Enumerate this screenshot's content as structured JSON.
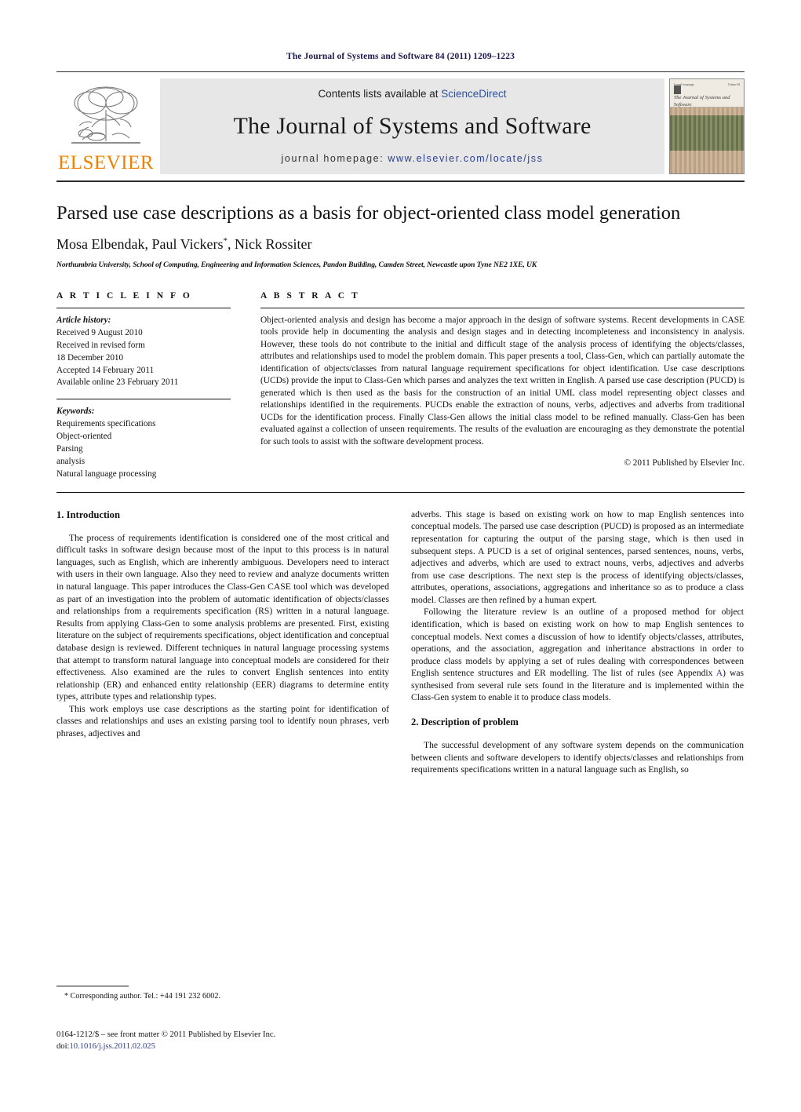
{
  "running_head": "The Journal of Systems and Software 84 (2011) 1209–1223",
  "masthead": {
    "publisher_name": "ELSEVIER",
    "contents_prefix": "Contents lists available at ",
    "sciencedirect": "ScienceDirect",
    "journal_name": "The Journal of Systems and Software",
    "homepage_prefix": "journal homepage: ",
    "homepage_url": "www.elsevier.com/locate/jss",
    "cover": {
      "title": "The Journal of Systems and Software",
      "header_left": "Journal  homepage",
      "header_right": "Volume 84"
    }
  },
  "article": {
    "title": "Parsed use case descriptions as a basis for object-oriented class model generation",
    "authors": "Mosa Elbendak, Paul Vickers",
    "authors_suffix": ", Nick Rossiter",
    "corresponding_marker": "*",
    "affiliation": "Northumbria University, School of Computing, Engineering and Information Sciences, Pandon Building, Camden Street, Newcastle upon Tyne NE2 1XE, UK"
  },
  "article_info": {
    "label": "A R T I C L E    I N F O",
    "history_label": "Article history:",
    "history": [
      "Received 9 August 2010",
      "Received in revised form",
      "18 December 2010",
      "Accepted 14 February 2011",
      "Available online 23 February 2011"
    ],
    "keywords_label": "Keywords:",
    "keywords": [
      "Requirements specifications",
      "Object-oriented",
      "Parsing",
      "analysis",
      "Natural language processing"
    ]
  },
  "abstract": {
    "label": "A B S T R A C T",
    "text": "Object-oriented analysis and design has become a major approach in the design of software systems. Recent developments in CASE tools provide help in documenting the analysis and design stages and in detecting incompleteness and inconsistency in analysis. However, these tools do not contribute to the initial and difficult stage of the analysis process of identifying the objects/classes, attributes and relationships used to model the problem domain. This paper presents a tool, Class-Gen, which can partially automate the identification of objects/classes from natural language requirement specifications for object identification. Use case descriptions (UCDs) provide the input to Class-Gen which parses and analyzes the text written in English. A parsed use case description (PUCD) is generated which is then used as the basis for the construction of an initial UML class model representing object classes and relationships identified in the requirements. PUCDs enable the extraction of nouns, verbs, adjectives and adverbs from traditional UCDs for the identification process. Finally Class-Gen allows the initial class model to be refined manually. Class-Gen has been evaluated against a collection of unseen requirements. The results of the evaluation are encouraging as they demonstrate the potential for such tools to assist with the software development process.",
    "copyright": "© 2011 Published by Elsevier Inc."
  },
  "body": {
    "left_column": {
      "section_number_title": "1.  Introduction",
      "paragraphs": [
        "The process of requirements identification is considered one of the most critical and difficult tasks in software design because most of the input to this process is in natural languages, such as English, which are inherently ambiguous. Developers need to interact with users in their own language. Also they need to review and analyze documents written in natural language. This paper introduces the Class-Gen CASE tool which was developed as part of an investigation into the problem of automatic identification of objects/classes and relationships from a requirements specification (RS) written in a natural language. Results from applying Class-Gen to some analysis problems are presented. First, existing literature on the subject of requirements specifications, object identification and conceptual database design is reviewed. Different techniques in natural language processing systems that attempt to transform natural language into conceptual models are considered for their effectiveness. Also examined are the rules to convert English sentences into entity relationship (ER) and enhanced entity relationship (EER) diagrams to determine entity types, attribute types and relationship types.",
        "This work employs use case descriptions as the starting point for identification of classes and relationships and uses an existing parsing tool to identify noun phrases, verb phrases, adjectives and"
      ]
    },
    "right_column": {
      "continuation": "adverbs. This stage is based on existing work on how to map English sentences into conceptual models. The parsed use case description (PUCD) is proposed as an intermediate representation for capturing the output of the parsing stage, which is then used in subsequent steps. A PUCD is a set of original sentences, parsed sentences, nouns, verbs, adjectives and adverbs, which are used to extract nouns, verbs, adjectives and adverbs from use case descriptions. The next step is the process of identifying objects/classes, attributes, operations, associations, aggregations and inheritance so as to produce a class model. Classes are then refined by a human expert.",
      "paragraph_2_before_link": "Following the literature review is an outline of a proposed method for object identification, which is based on existing work on how to map English sentences to conceptual models. Next comes a discussion of how to identify objects/classes, attributes, operations, and the association, aggregation and inheritance abstractions in order to produce class models by applying a set of rules dealing with correspondences between English sentence structures and ER modelling. The list of rules (see Appendix ",
      "paragraph_2_link": "A",
      "paragraph_2_after_link": ") was synthesised from several rule sets found in the literature and is implemented within the Class-Gen system to enable it to produce class models.",
      "section_number_title": "2.  Description of problem",
      "paragraph_3": "The successful development of any software system depends on the communication between clients and software developers to identify objects/classes and relationships from requirements specifications written in a natural language such as English, so"
    }
  },
  "footer": {
    "corresponding_note": "* Corresponding author. Tel.: +44 191 232 6002.",
    "front_matter": "0164-1212/$ – see front matter © 2011 Published by Elsevier Inc.",
    "doi_prefix": "doi:",
    "doi": "10.1016/j.jss.2011.02.025"
  },
  "colors": {
    "link_blue": "#2b3f8c",
    "elsevier_orange": "#f08000",
    "band_gray": "#e7e7e7",
    "running_head_navy": "#1a1a4e"
  }
}
